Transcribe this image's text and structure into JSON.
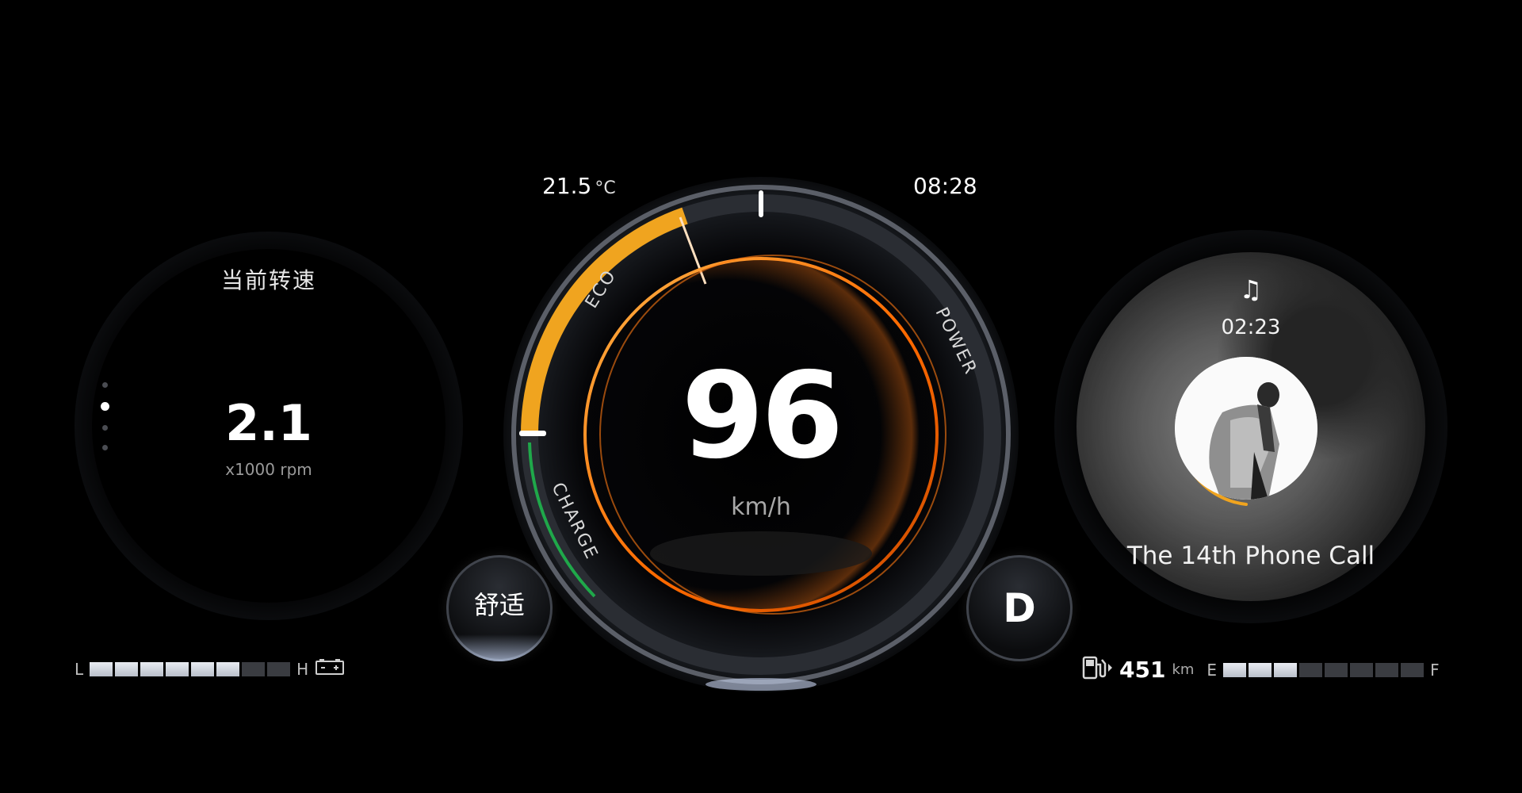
{
  "left_gauge": {
    "title": "当前转速",
    "value": "2.1",
    "unit": "x1000 rpm",
    "page_dots": {
      "count": 4,
      "active_index": 1
    }
  },
  "coolant_temp_bar": {
    "low_label": "L",
    "high_label": "H",
    "segments_total": 8,
    "segments_on": 6,
    "icon": "battery-icon"
  },
  "center_gauge": {
    "outside_temp": "21.5",
    "temp_unit": "°C",
    "clock": "08:28",
    "speed": "96",
    "speed_unit": "km/h",
    "mode_labels": {
      "eco": "ECO",
      "power": "POWER",
      "charge": "CHARGE"
    },
    "power_level_fraction": 0.4,
    "colors": {
      "eco_arc": "#f0a41f",
      "charge_arc": "#1fa84a",
      "speed_ring": "#ff7a12"
    }
  },
  "buttons": {
    "drive_mode": "舒适",
    "gear": "D"
  },
  "media": {
    "icon": "music-note-icon",
    "elapsed": "02:23",
    "song_title": "The 14th Phone Call",
    "progress_fraction": 0.32,
    "progress_color": "#f0a41f"
  },
  "fuel_bar": {
    "icon": "fuel-pump-icon",
    "range_value": "451",
    "range_unit": "km",
    "empty_label": "E",
    "full_label": "F",
    "segments_total": 8,
    "segments_on": 3
  }
}
